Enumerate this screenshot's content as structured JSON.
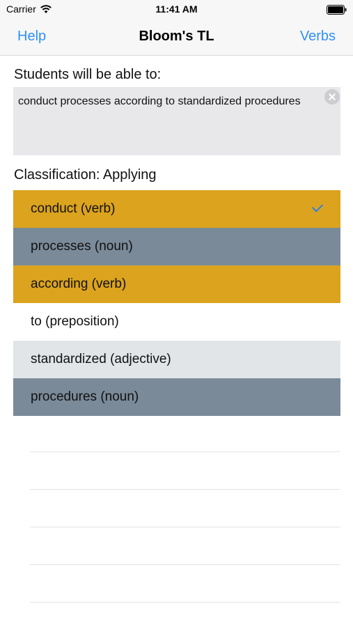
{
  "status_bar": {
    "carrier": "Carrier",
    "time": "11:41 AM",
    "wifi_icon": "wifi-icon",
    "battery_icon": "battery-icon"
  },
  "nav": {
    "left_button": "Help",
    "title": "Bloom's TL",
    "right_button": "Verbs"
  },
  "prompt_label": "Students will be able to:",
  "objective_text": "conduct processes according to standardized procedures",
  "classification": "Classification: Applying",
  "words": [
    {
      "label": "conduct (verb)",
      "type": "verb",
      "selected": true,
      "color": "#dba31e"
    },
    {
      "label": "processes (noun)",
      "type": "noun",
      "selected": false,
      "color": "#7a8a99"
    },
    {
      "label": "according (verb)",
      "type": "verb",
      "selected": false,
      "color": "#dba31e"
    },
    {
      "label": "to (preposition)",
      "type": "preposition",
      "selected": false,
      "color": "#ffffff"
    },
    {
      "label": "standardized (adjective)",
      "type": "adjective",
      "selected": false,
      "color": "#e1e5e8"
    },
    {
      "label": "procedures (noun)",
      "type": "noun",
      "selected": false,
      "color": "#7a8a99"
    }
  ],
  "colors": {
    "accent": "#2f8ff7",
    "verb": "#dba31e",
    "noun": "#7a8a99",
    "adjective": "#e1e5e8"
  }
}
